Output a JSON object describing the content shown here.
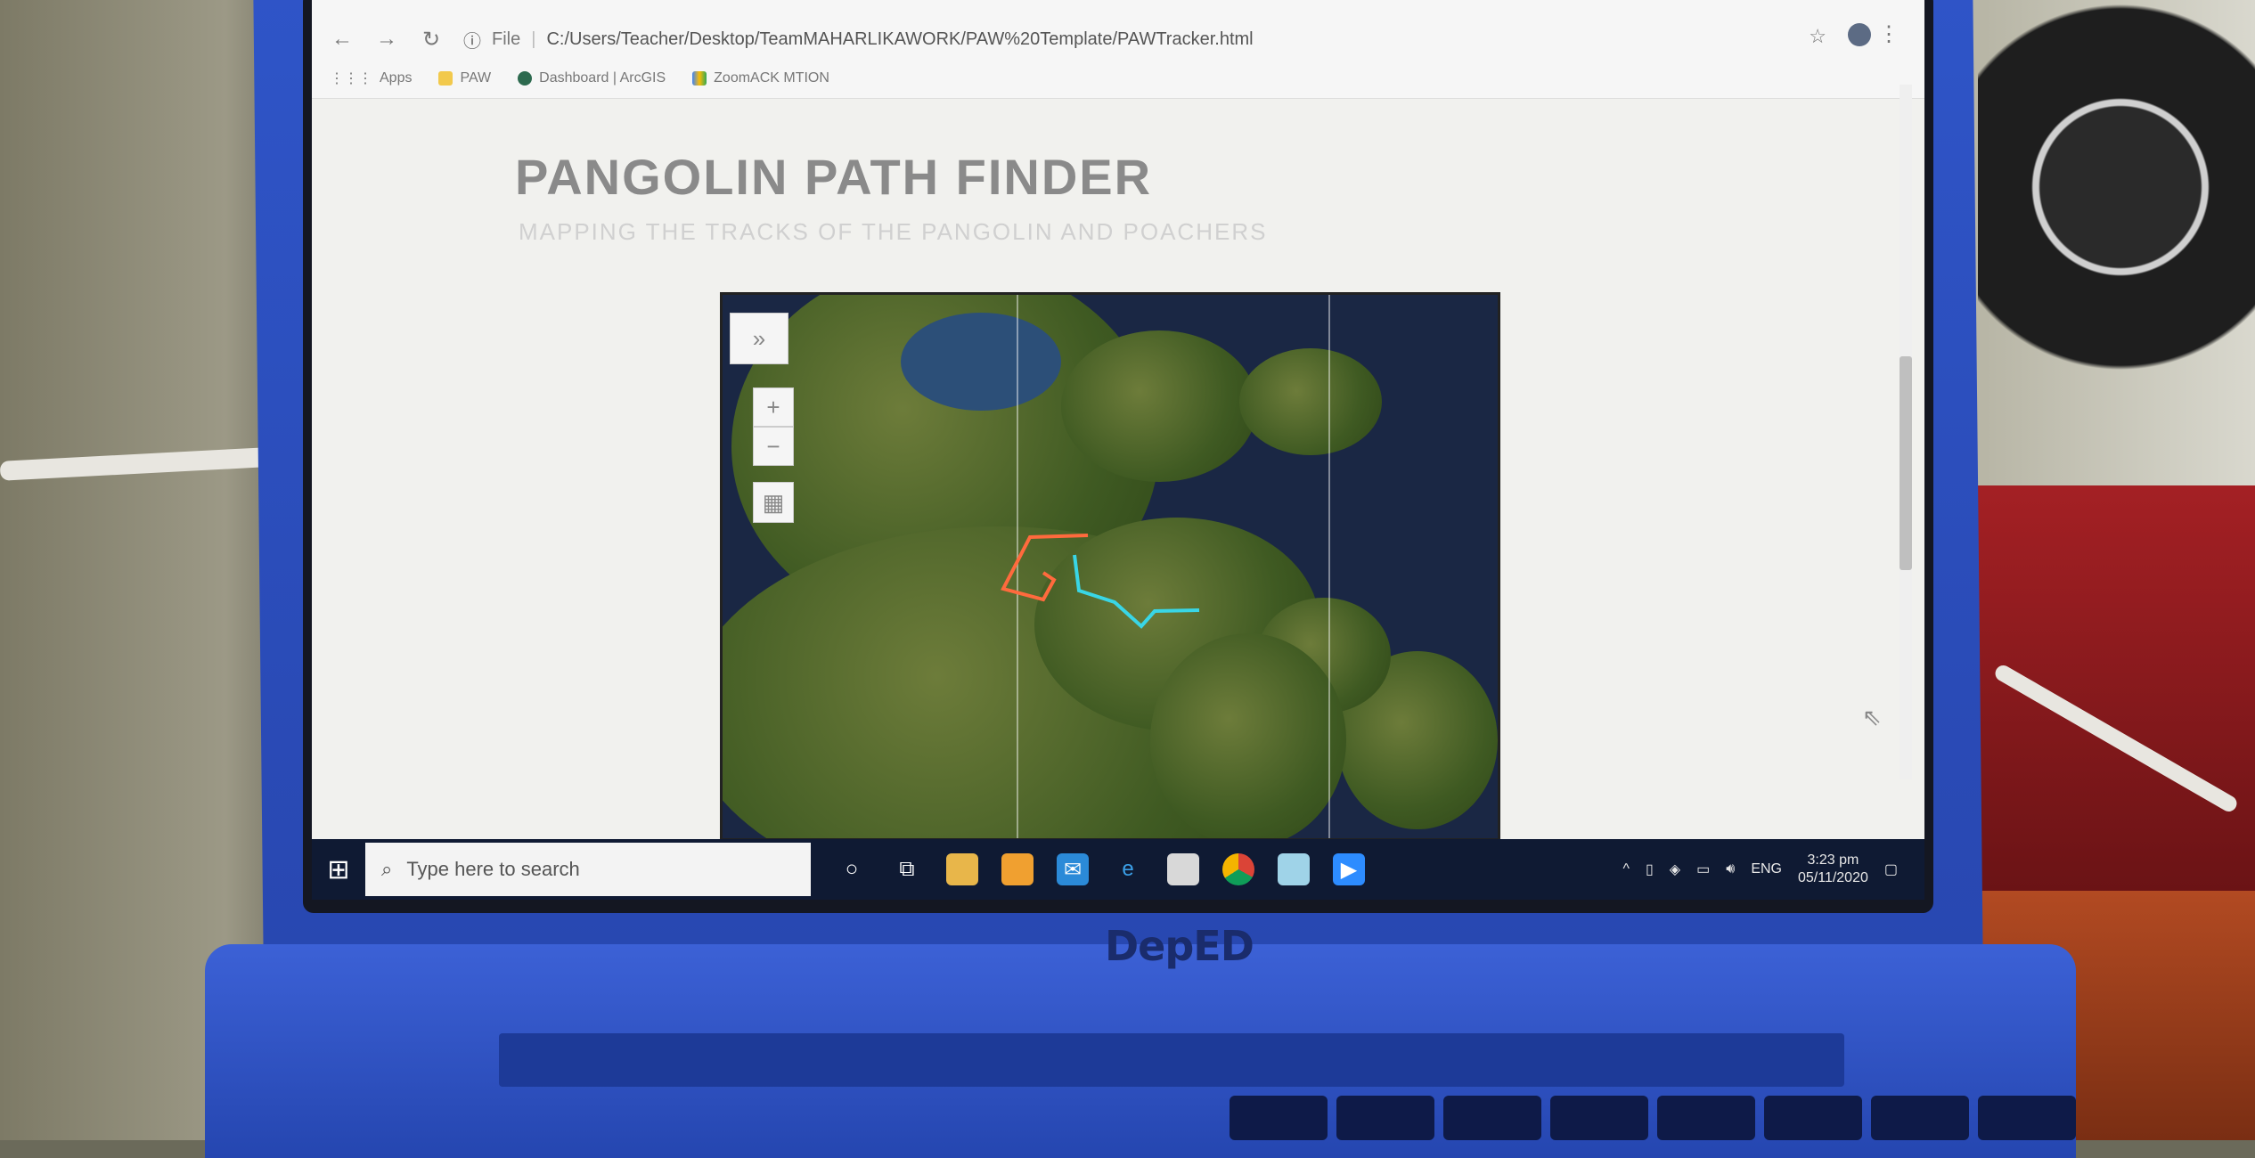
{
  "browser": {
    "url": "C:/Users/Teacher/Desktop/TeamMAHARLIKAWORK/PAW%20Template/PAWTracker.html",
    "file_label": "File",
    "bookmarks": [
      "Apps",
      "PAW",
      "Dashboard | ArcGIS",
      "ZoomACK MTION"
    ]
  },
  "page": {
    "title": "PANGOLIN PATH FINDER",
    "subtitle": "MAPPING THE TRACKS OF THE PANGOLIN AND POACHERS"
  },
  "map": {
    "expand_icon": "»",
    "zoom_in": "+",
    "zoom_out": "−",
    "track_colors": {
      "poacher": "#ff6a3d",
      "pangolin": "#39d6e6"
    }
  },
  "taskbar": {
    "search_placeholder": "Type here to search",
    "language": "ENG",
    "time": "3:23 pm",
    "date": "05/11/2020"
  },
  "laptop": {
    "brand": "DepED"
  }
}
